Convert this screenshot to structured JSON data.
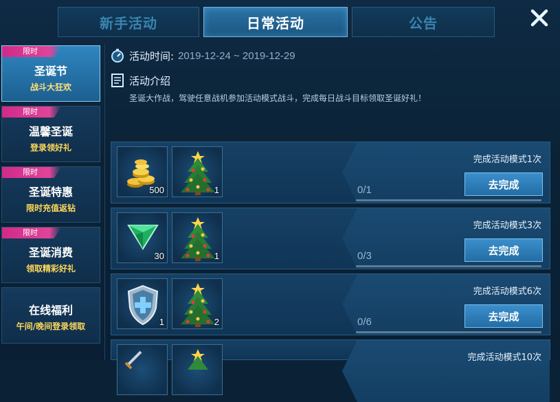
{
  "tabs": [
    {
      "label": "新手活动",
      "active": false
    },
    {
      "label": "日常活动",
      "active": true
    },
    {
      "label": "公告",
      "active": false
    }
  ],
  "close_icon": "close-x-icon",
  "sidebar": {
    "items": [
      {
        "ribbon": "限时",
        "title": "圣诞节",
        "subtitle": "战斗大狂欢",
        "active": true
      },
      {
        "ribbon": "限时",
        "title": "温馨圣诞",
        "subtitle": "登录领好礼",
        "active": false
      },
      {
        "ribbon": "限时",
        "title": "圣诞特惠",
        "subtitle": "限时充值返钻",
        "active": false
      },
      {
        "ribbon": "限时",
        "title": "圣诞消费",
        "subtitle": "领取精彩好礼",
        "active": false
      },
      {
        "ribbon": "",
        "title": "在线福利",
        "subtitle": "午间/晚间登录领取",
        "active": false
      }
    ]
  },
  "activity": {
    "time_label": "活动时间:",
    "time_value": "2019-12-24 ~ 2019-12-29",
    "intro_label": "活动介绍",
    "intro_text": "圣诞大作战，驾驶任意战机参加活动模式战斗，完成每日战斗目标领取圣诞好礼！"
  },
  "tasks": [
    {
      "rewards": [
        {
          "icon": "gold-coins-icon",
          "qty": "500"
        },
        {
          "icon": "christmas-tree-icon",
          "qty": "1"
        }
      ],
      "goal": "完成活动模式1次",
      "progress": "0/1",
      "progress_fraction": 0,
      "button": "去完成"
    },
    {
      "rewards": [
        {
          "icon": "green-gem-icon",
          "qty": "30"
        },
        {
          "icon": "christmas-tree-icon",
          "qty": "1"
        }
      ],
      "goal": "完成活动模式3次",
      "progress": "0/3",
      "progress_fraction": 0,
      "button": "去完成"
    },
    {
      "rewards": [
        {
          "icon": "shield-plus-icon",
          "qty": "1"
        },
        {
          "icon": "christmas-tree-icon",
          "qty": "2"
        }
      ],
      "goal": "完成活动模式6次",
      "progress": "0/6",
      "progress_fraction": 0,
      "button": "去完成"
    },
    {
      "rewards": [
        {
          "icon": "sword-icon",
          "qty": ""
        },
        {
          "icon": "christmas-tree-icon",
          "qty": ""
        }
      ],
      "goal": "完成活动模式10次",
      "progress": "",
      "progress_fraction": 0,
      "button": ""
    }
  ],
  "colors": {
    "accent": "#2a74a6",
    "ribbon": "#d02a8a",
    "subtitle": "#ffd85a",
    "button": "#236da5"
  }
}
